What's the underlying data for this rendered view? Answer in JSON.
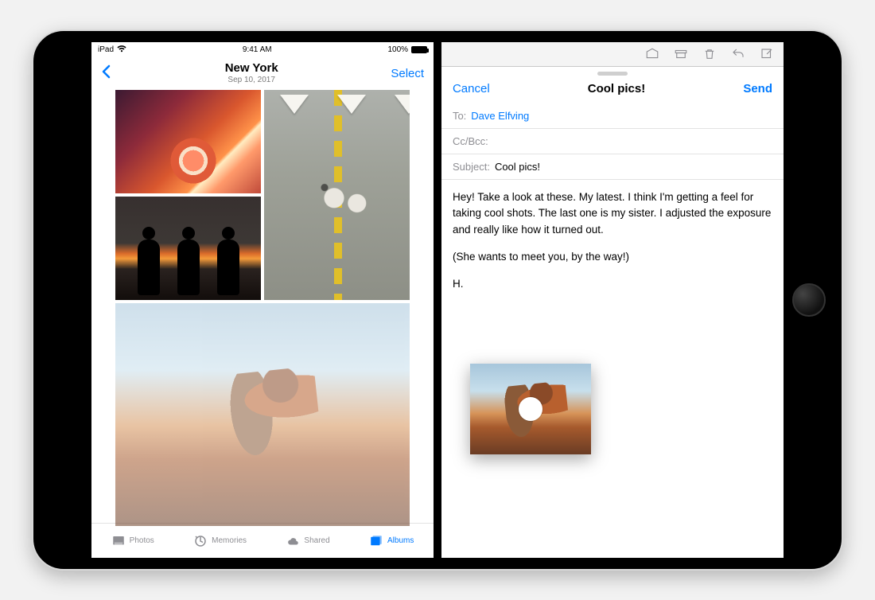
{
  "status_bar": {
    "carrier": "iPad",
    "time": "9:41 AM",
    "battery_pct": "100%"
  },
  "photos": {
    "nav_title": "New York",
    "nav_subtitle": "Sep 10, 2017",
    "select_label": "Select",
    "tabs": {
      "photos": "Photos",
      "memories": "Memories",
      "shared": "Shared",
      "albums": "Albums"
    }
  },
  "mail": {
    "cancel_label": "Cancel",
    "send_label": "Send",
    "title": "Cool pics!",
    "to_label": "To:",
    "to_value": "Dave Elfving",
    "ccbcc_label": "Cc/Bcc:",
    "subject_label": "Subject:",
    "subject_value": "Cool pics!",
    "body_p1": "Hey! Take a look at these. My latest. I think I'm getting a feel for taking cool shots. The last one is my sister. I adjusted the exposure and really like how it turned out.",
    "body_p2": "(She wants to meet you, by the way!)",
    "body_p3": "H."
  }
}
